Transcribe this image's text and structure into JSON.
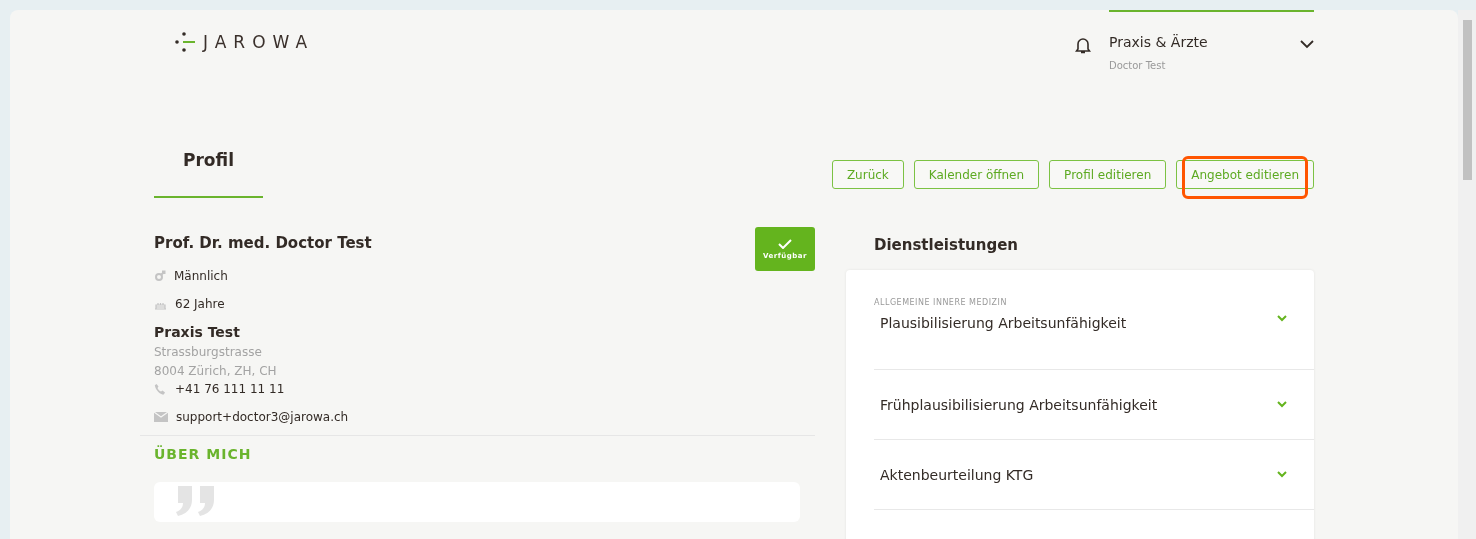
{
  "header": {
    "logo": "JAROWA",
    "account": {
      "title": "Praxis & Ärzte",
      "subtitle": "Doctor Test"
    }
  },
  "tabs": [
    {
      "label": "Profil",
      "selected": true
    }
  ],
  "actions": [
    {
      "label": "Zurück",
      "highlighted": false
    },
    {
      "label": "Kalender öffnen",
      "highlighted": false
    },
    {
      "label": "Profil editieren",
      "highlighted": false
    },
    {
      "label": "Angebot editieren",
      "highlighted": true
    }
  ],
  "profile": {
    "name": "Prof. Dr. med. Doctor Test",
    "status": {
      "label": "Verfügbar",
      "available": true
    },
    "details": [
      {
        "kind": "gender",
        "text": "Männlich"
      },
      {
        "kind": "age",
        "text": "62 Jahre"
      }
    ],
    "practice": "Praxis Test",
    "address": [
      "Strassburgstrasse",
      "8004 Zürich, ZH, CH"
    ],
    "contacts": [
      {
        "kind": "phone",
        "text": "+41 76 111 11 11"
      },
      {
        "kind": "email",
        "text": "support+doctor3@jarowa.ch"
      }
    ],
    "about_heading": "ÜBER MICH"
  },
  "services": {
    "heading": "Dienstleistungen",
    "category": "ALLGEMEINE INNERE MEDIZIN",
    "items": [
      {
        "label": "Plausibilisierung Arbeitsunfähigkeit",
        "expanded": false
      },
      {
        "label": "Frühplausibilisierung Arbeitsunfähigkeit",
        "expanded": false
      },
      {
        "label": "Aktenbeurteilung KTG",
        "expanded": false
      }
    ]
  }
}
